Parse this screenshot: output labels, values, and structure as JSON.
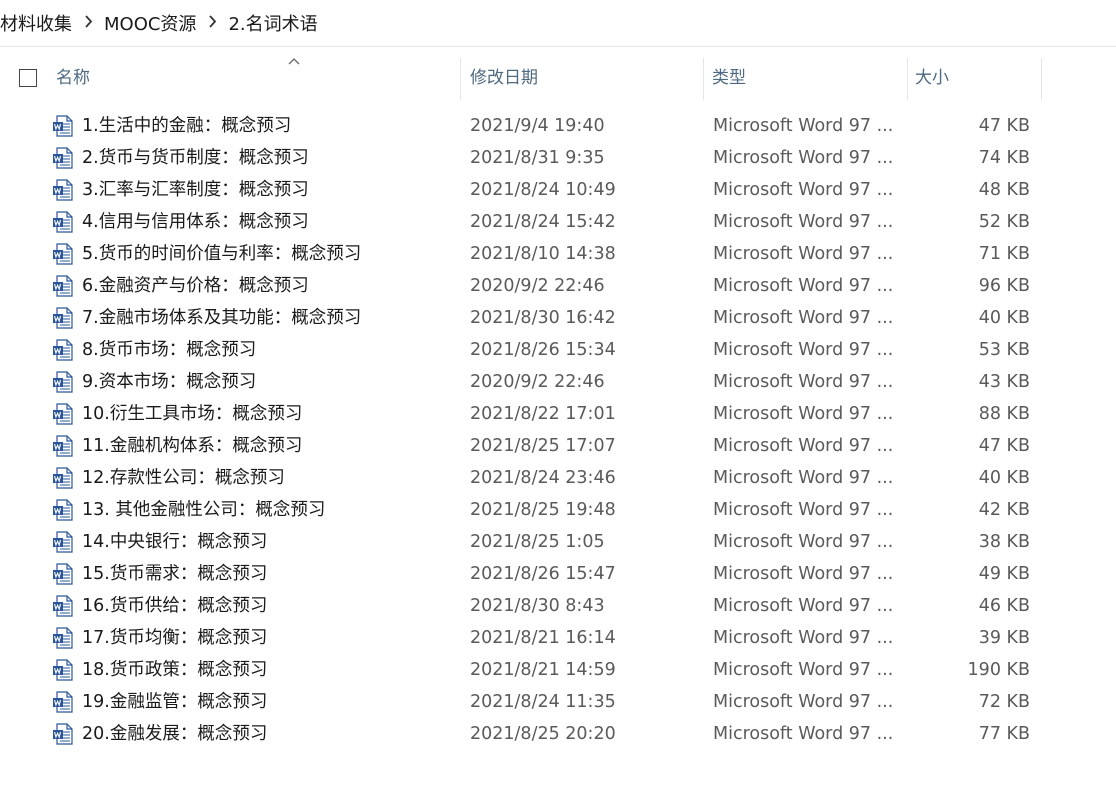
{
  "breadcrumb": {
    "items": [
      "材料收集",
      "MOOC资源",
      "2.名词术语"
    ],
    "separator_icon": "chevron-right-icon"
  },
  "columns": {
    "name": "名称",
    "date": "修改日期",
    "type": "类型",
    "size": "大小",
    "sort_indicator": "sort-ascending-icon"
  },
  "colors": {
    "header_text": "#4d6a82",
    "secondary_text": "#5a5a5a",
    "word_icon_blue": "#2b579a"
  },
  "files": [
    {
      "name": "1.生活中的金融：概念预习",
      "date": "2021/9/4 19:40",
      "type": "Microsoft Word 97 ...",
      "size": "47 KB",
      "icon": "word-document-icon"
    },
    {
      "name": "2.货币与货币制度：概念预习",
      "date": "2021/8/31 9:35",
      "type": "Microsoft Word 97 ...",
      "size": "74 KB",
      "icon": "word-document-icon"
    },
    {
      "name": "3.汇率与汇率制度：概念预习",
      "date": "2021/8/24 10:49",
      "type": "Microsoft Word 97 ...",
      "size": "48 KB",
      "icon": "word-document-icon"
    },
    {
      "name": "4.信用与信用体系：概念预习",
      "date": "2021/8/24 15:42",
      "type": "Microsoft Word 97 ...",
      "size": "52 KB",
      "icon": "word-document-icon"
    },
    {
      "name": "5.货币的时间价值与利率：概念预习",
      "date": "2021/8/10 14:38",
      "type": "Microsoft Word 97 ...",
      "size": "71 KB",
      "icon": "word-document-icon"
    },
    {
      "name": "6.金融资产与价格：概念预习",
      "date": "2020/9/2 22:46",
      "type": "Microsoft Word 97 ...",
      "size": "96 KB",
      "icon": "word-document-icon"
    },
    {
      "name": "7.金融市场体系及其功能：概念预习",
      "date": "2021/8/30 16:42",
      "type": "Microsoft Word 97 ...",
      "size": "40 KB",
      "icon": "word-document-icon"
    },
    {
      "name": "8.货币市场：概念预习",
      "date": "2021/8/26 15:34",
      "type": "Microsoft Word 97 ...",
      "size": "53 KB",
      "icon": "word-document-icon"
    },
    {
      "name": "9.资本市场：概念预习",
      "date": "2020/9/2 22:46",
      "type": "Microsoft Word 97 ...",
      "size": "43 KB",
      "icon": "word-document-icon"
    },
    {
      "name": "10.衍生工具市场：概念预习",
      "date": "2021/8/22 17:01",
      "type": "Microsoft Word 97 ...",
      "size": "88 KB",
      "icon": "word-document-icon"
    },
    {
      "name": "11.金融机构体系：概念预习",
      "date": "2021/8/25 17:07",
      "type": "Microsoft Word 97 ...",
      "size": "47 KB",
      "icon": "word-document-icon"
    },
    {
      "name": "12.存款性公司：概念预习",
      "date": "2021/8/24 23:46",
      "type": "Microsoft Word 97 ...",
      "size": "40 KB",
      "icon": "word-document-icon"
    },
    {
      "name": "13. 其他金融性公司：概念预习",
      "date": "2021/8/25 19:48",
      "type": "Microsoft Word 97 ...",
      "size": "42 KB",
      "icon": "word-document-icon"
    },
    {
      "name": "14.中央银行：概念预习",
      "date": "2021/8/25 1:05",
      "type": "Microsoft Word 97 ...",
      "size": "38 KB",
      "icon": "word-document-icon"
    },
    {
      "name": "15.货币需求：概念预习",
      "date": "2021/8/26 15:47",
      "type": "Microsoft Word 97 ...",
      "size": "49 KB",
      "icon": "word-document-icon"
    },
    {
      "name": "16.货币供给：概念预习",
      "date": "2021/8/30 8:43",
      "type": "Microsoft Word 97 ...",
      "size": "46 KB",
      "icon": "word-document-icon"
    },
    {
      "name": "17.货币均衡：概念预习",
      "date": "2021/8/21 16:14",
      "type": "Microsoft Word 97 ...",
      "size": "39 KB",
      "icon": "word-document-icon"
    },
    {
      "name": "18.货币政策：概念预习",
      "date": "2021/8/21 14:59",
      "type": "Microsoft Word 97 ...",
      "size": "190 KB",
      "icon": "word-document-icon"
    },
    {
      "name": "19.金融监管：概念预习",
      "date": "2021/8/24 11:35",
      "type": "Microsoft Word 97 ...",
      "size": "72 KB",
      "icon": "word-document-icon"
    },
    {
      "name": "20.金融发展：概念预习",
      "date": "2021/8/25 20:20",
      "type": "Microsoft Word 97 ...",
      "size": "77 KB",
      "icon": "word-document-icon"
    }
  ]
}
